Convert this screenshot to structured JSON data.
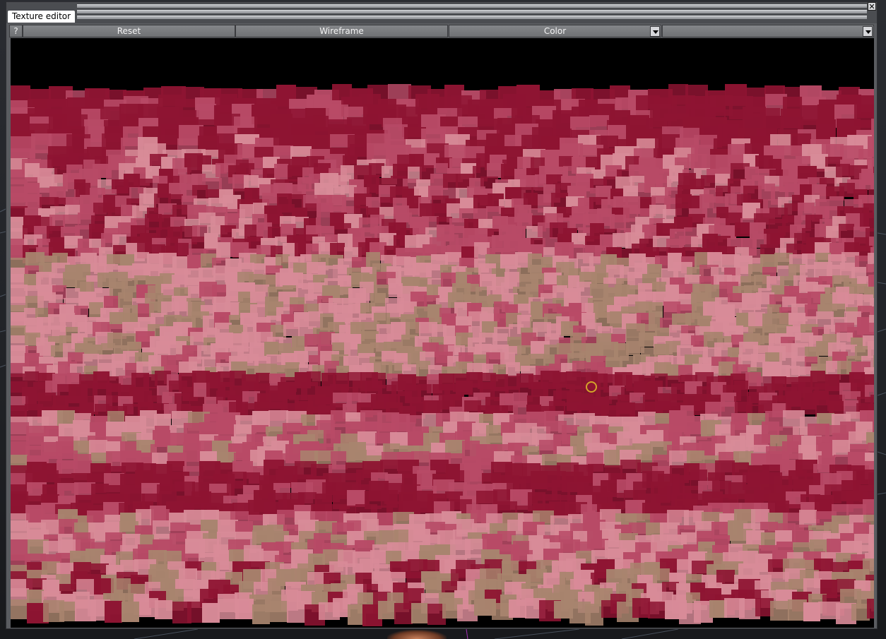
{
  "window": {
    "title": "Texture editor",
    "close_glyph": "✕"
  },
  "toolbar": {
    "help_label": "?",
    "reset_label": "Reset",
    "wireframe_label": "Wireframe",
    "color_select_value": "Color",
    "second_select_value": ""
  },
  "icons": {
    "close": "close-icon",
    "dropdown": "chevron-down-icon",
    "cursor": "circle-cursor-icon"
  },
  "colors": {
    "deep_red": "#8e1432",
    "rose": "#b84a66",
    "pink": "#d88b98",
    "tan": "#a8846e",
    "background": "#000000"
  }
}
